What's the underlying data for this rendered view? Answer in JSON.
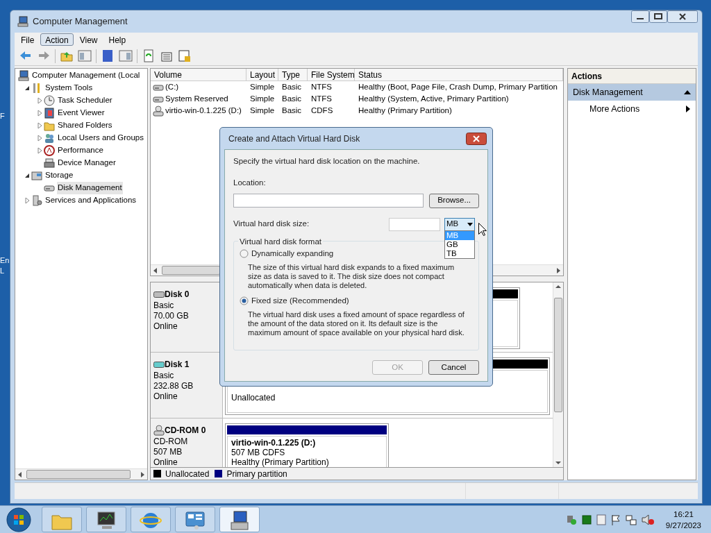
{
  "desktop_labels": [
    "F",
    "En",
    "L"
  ],
  "window": {
    "title": "Computer Management"
  },
  "menu": [
    {
      "label": "File",
      "selected": false
    },
    {
      "label": "Action",
      "selected": true
    },
    {
      "label": "View",
      "selected": false
    },
    {
      "label": "Help",
      "selected": false
    }
  ],
  "tree": [
    {
      "label": "Computer Management (Local",
      "kind": "computer",
      "selected": false,
      "children": [
        {
          "label": "System Tools",
          "kind": "tools",
          "expanded": true,
          "selected": false,
          "children": [
            {
              "label": "Task Scheduler",
              "kind": "clock",
              "expanded": false,
              "selected": false
            },
            {
              "label": "Event Viewer",
              "kind": "log",
              "expanded": false,
              "selected": false
            },
            {
              "label": "Shared Folders",
              "kind": "folder",
              "expanded": false,
              "selected": false
            },
            {
              "label": "Local Users and Groups",
              "kind": "users",
              "expanded": false,
              "selected": false
            },
            {
              "label": "Performance",
              "kind": "perf",
              "expanded": false,
              "selected": false
            },
            {
              "label": "Device Manager",
              "kind": "device",
              "selected": false
            }
          ]
        },
        {
          "label": "Storage",
          "kind": "storage",
          "expanded": true,
          "selected": false,
          "children": [
            {
              "label": "Disk Management",
              "kind": "disk",
              "selected": true
            }
          ]
        },
        {
          "label": "Services and Applications",
          "kind": "services",
          "expanded": false,
          "selected": false
        }
      ]
    }
  ],
  "volumes": {
    "columns": [
      "Volume",
      "Layout",
      "Type",
      "File System",
      "Status"
    ],
    "rows": [
      {
        "kind": "disk",
        "cells": [
          "(C:)",
          "Simple",
          "Basic",
          "NTFS",
          "Healthy (Boot, Page File, Crash Dump, Primary Partition"
        ]
      },
      {
        "kind": "disk",
        "cells": [
          "System Reserved",
          "Simple",
          "Basic",
          "NTFS",
          "Healthy (System, Active, Primary Partition)"
        ]
      },
      {
        "kind": "cd",
        "cells": [
          "virtio-win-0.1.225 (D:)",
          "Simple",
          "Basic",
          "CDFS",
          "Healthy (Primary Partition)"
        ]
      }
    ]
  },
  "disks": [
    {
      "kind": "hdd",
      "name": "Disk 0",
      "lines": [
        "Basic",
        "70.00 GB",
        "Online"
      ],
      "partitions": [
        {
          "kind": "unallocated"
        }
      ]
    },
    {
      "kind": "hdd_new",
      "name": "Disk 1",
      "lines": [
        "Basic",
        "232.88 GB",
        "Online"
      ],
      "partitions": [
        {
          "kind": "unallocated",
          "lines": [
            "Unallocated"
          ]
        }
      ]
    },
    {
      "kind": "cd",
      "name": "CD-ROM 0",
      "lines": [
        "CD-ROM",
        "507 MB",
        "Online"
      ],
      "partitions": [
        {
          "kind": "primary",
          "title": "virtio-win-0.1.225  (D:)",
          "lines": [
            "507 MB CDFS",
            "Healthy (Primary Partition)"
          ]
        }
      ]
    }
  ],
  "legend": [
    {
      "label": "Unallocated",
      "color": "#000000"
    },
    {
      "label": "Primary partition",
      "color": "#000080"
    }
  ],
  "actions": {
    "title": "Actions",
    "section": {
      "label": "Disk Management",
      "expanded": true
    },
    "items": [
      "More Actions"
    ]
  },
  "dialog": {
    "title": "Create and Attach Virtual Hard Disk",
    "instruction": "Specify the virtual hard disk location on the machine.",
    "location_label": "Location:",
    "browse_button": "Browse...",
    "size_label": "Virtual hard disk size:",
    "unit": {
      "value": "MB",
      "open": true,
      "options": [
        {
          "label": "MB",
          "selected": true
        },
        {
          "label": "GB",
          "selected": false
        },
        {
          "label": "TB",
          "selected": false
        }
      ]
    },
    "format_label": "Virtual hard disk format",
    "formats": [
      {
        "label": "Dynamically expanding",
        "selected": false,
        "description": "The size of this virtual hard disk expands to a fixed maximum size as data is saved to it.  The disk size does not compact automatically when data is deleted."
      },
      {
        "label": "Fixed size (Recommended)",
        "selected": true,
        "description": "The virtual hard disk uses a fixed amount of space regardless of the amount of the data stored on it.  Its default size is the maximum amount of space available on your physical hard disk."
      }
    ],
    "buttons": [
      {
        "label": "OK",
        "disabled": true
      },
      {
        "label": "Cancel",
        "disabled": false
      }
    ]
  },
  "taskbar": {
    "apps": [
      {
        "kind": "explorer",
        "selected": false
      },
      {
        "kind": "monitor",
        "selected": false
      },
      {
        "kind": "browser",
        "selected": false
      },
      {
        "kind": "panel",
        "selected": false
      },
      {
        "kind": "manager",
        "selected": true
      }
    ],
    "clock": {
      "time": "16:21",
      "date": "9/27/2023"
    }
  }
}
